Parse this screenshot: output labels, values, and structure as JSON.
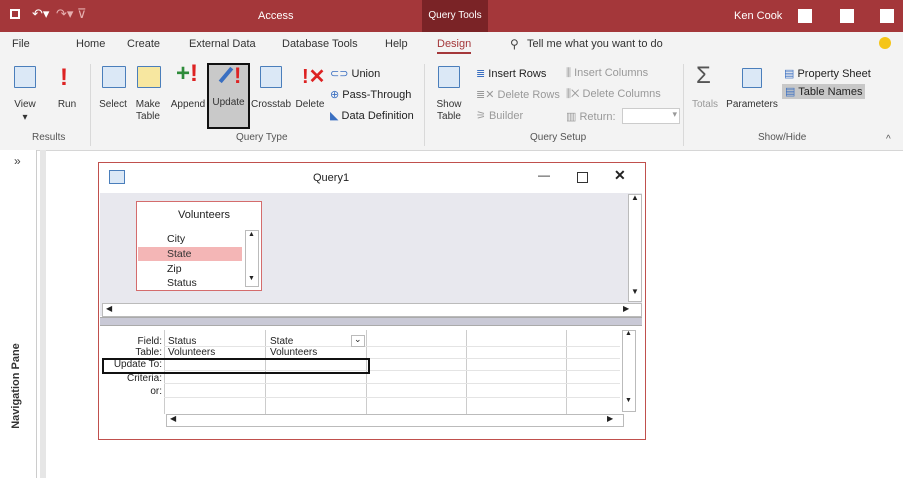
{
  "titlebar": {
    "app_title": "Access",
    "context_tab": "Query Tools",
    "user": "Ken Cook",
    "accent": "#a4373a"
  },
  "tabs": [
    "File",
    "Home",
    "Create",
    "External Data",
    "Database Tools",
    "Help",
    "Design"
  ],
  "tell_me": "Tell me what you want to do",
  "ribbon": {
    "results": {
      "view": "View",
      "run": "Run",
      "group": "Results"
    },
    "query_type": {
      "select": "Select",
      "make": "Make",
      "make2": "Table",
      "append": "Append",
      "update": "Update",
      "crosstab": "Crosstab",
      "delete": "Delete",
      "union": "Union",
      "pass_through": "Pass-Through",
      "data_definition": "Data Definition",
      "group": "Query Type"
    },
    "query_setup": {
      "show": "Show",
      "show2": "Table",
      "insert_rows": "Insert Rows",
      "delete_rows": "Delete Rows",
      "builder": "Builder",
      "insert_columns": "Insert Columns",
      "delete_columns": "Delete Columns",
      "return": "Return:",
      "group": "Query Setup"
    },
    "show_hide": {
      "totals": "Totals",
      "parameters": "Parameters",
      "property_sheet": "Property Sheet",
      "table_names": "Table Names",
      "group": "Show/Hide"
    }
  },
  "nav_pane": {
    "label": "Navigation Pane",
    "toggle": "»"
  },
  "query_window": {
    "title": "Query1",
    "table": {
      "name": "Volunteers",
      "fields": [
        "City",
        "State",
        "Zip",
        "Status"
      ],
      "selected": "State"
    },
    "grid": {
      "row_labels": [
        "Field:",
        "Table:",
        "Update To:",
        "Criteria:",
        "or:"
      ],
      "columns": [
        {
          "field": "Status",
          "table": "Volunteers"
        },
        {
          "field": "State",
          "table": "Volunteers"
        }
      ]
    }
  }
}
